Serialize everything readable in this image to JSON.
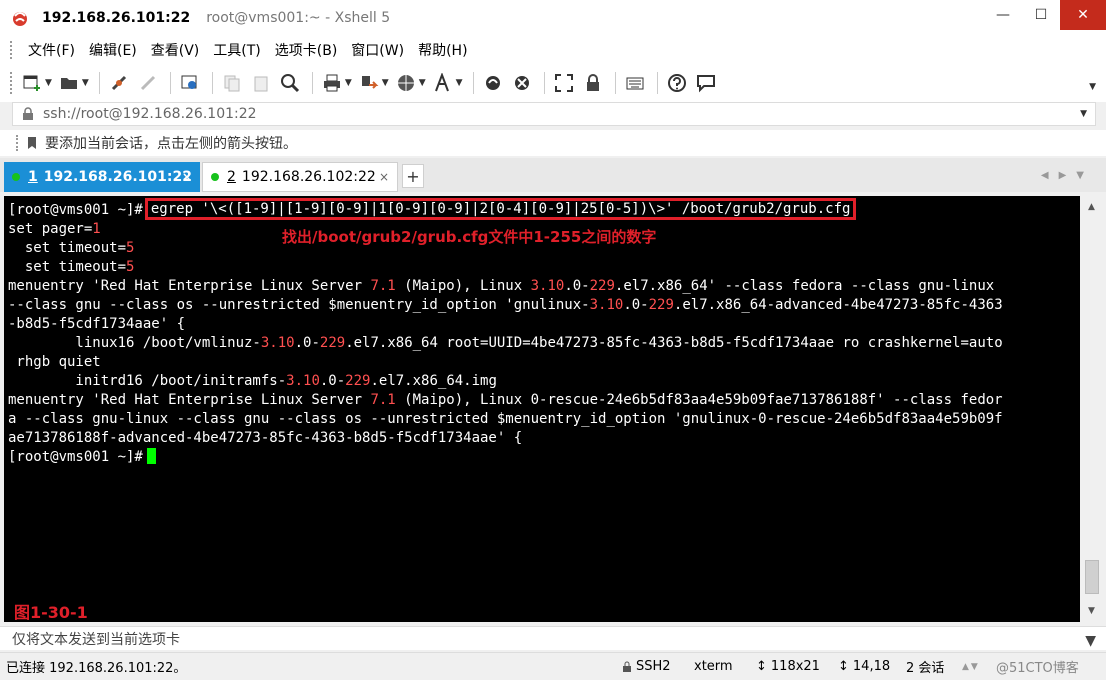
{
  "window": {
    "title_host": "192.168.26.101:22",
    "title_sub": "root@vms001:~ - Xshell 5",
    "min_label": "—",
    "max_label": "☐",
    "close_label": "✕"
  },
  "menu": {
    "items": [
      "文件(F)",
      "编辑(E)",
      "查看(V)",
      "工具(T)",
      "选项卡(B)",
      "窗口(W)",
      "帮助(H)"
    ]
  },
  "address": {
    "value": "ssh://root@192.168.26.101:22"
  },
  "hint": {
    "text": "要添加当前会话，点击左侧的箭头按钮。"
  },
  "tabs": [
    {
      "number": "1",
      "label": "192.168.26.101:22",
      "close": "×"
    },
    {
      "number": "2",
      "label": "192.168.26.102:22",
      "close": "×"
    }
  ],
  "tab_add_label": "+",
  "terminal": {
    "prompt": "[root@vms001 ~]#",
    "command": "egrep '\\<([1-9]|[1-9][0-9]|1[0-9][0-9]|2[0-4][0-9]|25[0-5])\\>' /boot/grub2/grub.cfg",
    "annotation": "找出/boot/grub2/grub.cfg文件中1-255之间的数字",
    "figure_label": "图1-30-1",
    "output": [
      {
        "segments": [
          {
            "t": "set pager="
          },
          {
            "t": "1",
            "hl": true
          }
        ]
      },
      {
        "segments": [
          {
            "t": "  set timeout="
          },
          {
            "t": "5",
            "hl": true
          }
        ]
      },
      {
        "segments": [
          {
            "t": "  set timeout="
          },
          {
            "t": "5",
            "hl": true
          }
        ]
      },
      {
        "segments": [
          {
            "t": "menuentry 'Red Hat Enterprise Linux Server "
          },
          {
            "t": "7.1",
            "hl": true
          },
          {
            "t": " (Maipo), Linux "
          },
          {
            "t": "3.10",
            "hl": true
          },
          {
            "t": ".0-"
          },
          {
            "t": "229",
            "hl": true
          },
          {
            "t": ".el7.x86_64' --class fedora --class gnu-linux"
          }
        ]
      },
      {
        "segments": [
          {
            "t": "--class gnu --class os --unrestricted $menuentry_id_option 'gnulinux-"
          },
          {
            "t": "3.10",
            "hl": true
          },
          {
            "t": ".0-"
          },
          {
            "t": "229",
            "hl": true
          },
          {
            "t": ".el7.x86_64-advanced-4be47273-85fc-4363"
          }
        ]
      },
      {
        "segments": [
          {
            "t": "-b8d5-f5cdf1734aae' {"
          }
        ]
      },
      {
        "segments": [
          {
            "t": "        linux16 /boot/vmlinuz-"
          },
          {
            "t": "3.10",
            "hl": true
          },
          {
            "t": ".0-"
          },
          {
            "t": "229",
            "hl": true
          },
          {
            "t": ".el7.x86_64 root=UUID=4be47273-85fc-4363-b8d5-f5cdf1734aae ro crashkernel=auto"
          }
        ]
      },
      {
        "segments": [
          {
            "t": " rhgb quiet"
          }
        ]
      },
      {
        "segments": [
          {
            "t": "        initrd16 /boot/initramfs-"
          },
          {
            "t": "3.10",
            "hl": true
          },
          {
            "t": ".0-"
          },
          {
            "t": "229",
            "hl": true
          },
          {
            "t": ".el7.x86_64.img"
          }
        ]
      },
      {
        "segments": [
          {
            "t": "menuentry 'Red Hat Enterprise Linux Server "
          },
          {
            "t": "7.1",
            "hl": true
          },
          {
            "t": " (Maipo), Linux 0-rescue-24e6b5df83aa4e59b09fae713786188f' --class fedor"
          }
        ]
      },
      {
        "segments": [
          {
            "t": "a --class gnu-linux --class gnu --class os --unrestricted $menuentry_id_option 'gnulinux-0-rescue-24e6b5df83aa4e59b09f"
          }
        ]
      },
      {
        "segments": [
          {
            "t": "ae713786188f-advanced-4be47273-85fc-4363-b8d5-f5cdf1734aae' {"
          }
        ]
      }
    ]
  },
  "sendbar": {
    "text": "仅将文本发送到当前选项卡"
  },
  "status": {
    "connection": "已连接 192.168.26.101:22。",
    "protocol": "SSH2",
    "term": "xterm",
    "size": "118x21",
    "position": "14,18",
    "sessions": "2 会话",
    "watermark": "@51CTO博客"
  },
  "colors": {
    "terminal_bg": "#000000",
    "terminal_fg": "#ffffff",
    "number_highlight": "#ff5050",
    "annotation_red": "#e0202a",
    "cursor": "#00ff00",
    "active_tab": "#1b8fd6",
    "session_dot": "#17c21c"
  }
}
